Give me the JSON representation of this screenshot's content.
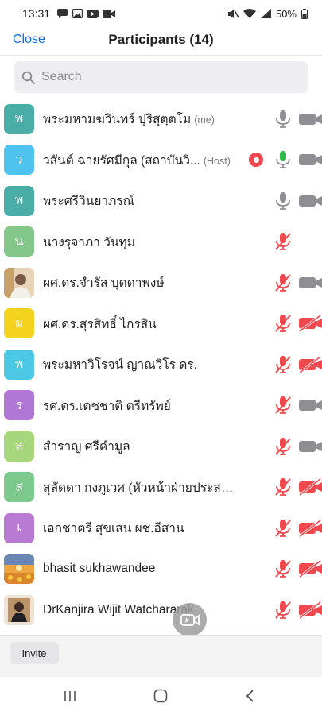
{
  "status_bar": {
    "time": "13:31",
    "battery": "50%"
  },
  "header": {
    "close_label": "Close",
    "title": "Participants (14)"
  },
  "search": {
    "placeholder": "Search"
  },
  "colors": {
    "accent": "#0e71eb",
    "muted": "#f0484f",
    "unmuted_mic": "#2fb84a",
    "icon_gray": "#8f8f93"
  },
  "participants": [
    {
      "name": "พระมหามฆวินทร์ ปุริสุตฺตโม",
      "tag": "(me)",
      "initial": "พ",
      "color": "#4bada7",
      "mic": "on",
      "video": "off",
      "recording": false
    },
    {
      "name": "วสันต์ ฉายรัศมีกุล (สถาบันวิ...",
      "tag": "(Host)",
      "initial": "ว",
      "color": "#4ec3f0",
      "mic": "speaking",
      "video": "off",
      "recording": true
    },
    {
      "name": "พระศรีวินยาภรณ์",
      "tag": "",
      "initial": "พ",
      "color": "#4bada7",
      "mic": "on",
      "video": "off",
      "recording": false
    },
    {
      "name": "นางรุจาภา  วันทุม",
      "tag": "",
      "initial": "น",
      "color": "#83c78b",
      "mic": "muted",
      "video": "none",
      "recording": false
    },
    {
      "name": "ผศ.ดร.จำรัส บุดดาพงษ์",
      "tag": "",
      "initial": "",
      "color": "#d8b89c",
      "photo": true,
      "mic": "muted",
      "video": "off",
      "recording": false
    },
    {
      "name": "ผศ.ดร.สุรสิทธิ์  ไกรสิน",
      "tag": "",
      "initial": "ผ",
      "color": "#f4d31f",
      "mic": "muted",
      "video": "muted",
      "recording": false
    },
    {
      "name": "พระมหาวิโรจน์ ญาณวิโร ดร.",
      "tag": "",
      "initial": "พ",
      "color": "#4cc7e4",
      "mic": "muted",
      "video": "muted",
      "recording": false
    },
    {
      "name": "รศ.ดร.เดชชาติ  ตรีทรัพย์",
      "tag": "",
      "initial": "ร",
      "color": "#b177d4",
      "mic": "muted",
      "video": "off",
      "recording": false
    },
    {
      "name": "สำราญ ศรีคำมูล",
      "tag": "",
      "initial": "ส",
      "color": "#a8d67c",
      "mic": "muted",
      "video": "off",
      "recording": false
    },
    {
      "name": "สุลัดดา  กงภูเวศ (หัวหน้าฝ่ายประสานง...",
      "tag": "",
      "initial": "ส",
      "color": "#7dc98d",
      "mic": "muted",
      "video": "muted",
      "recording": false
    },
    {
      "name": "เอกชาตรี สุขเสน ผช.อีสาน",
      "tag": "",
      "initial": "เ",
      "color": "#b87ad2",
      "mic": "muted",
      "video": "muted",
      "recording": false
    },
    {
      "name": "bhasit sukhawandee",
      "tag": "",
      "initial": "",
      "color": "#e09a3b",
      "photo": true,
      "mic": "muted",
      "video": "muted",
      "recording": false
    },
    {
      "name": "DrKanjira Wijit Watchararak",
      "tag": "",
      "initial": "",
      "color": "#caa27e",
      "photo": true,
      "mic": "muted",
      "video": "muted",
      "recording": false
    }
  ],
  "bottom": {
    "invite_label": "Invite"
  }
}
